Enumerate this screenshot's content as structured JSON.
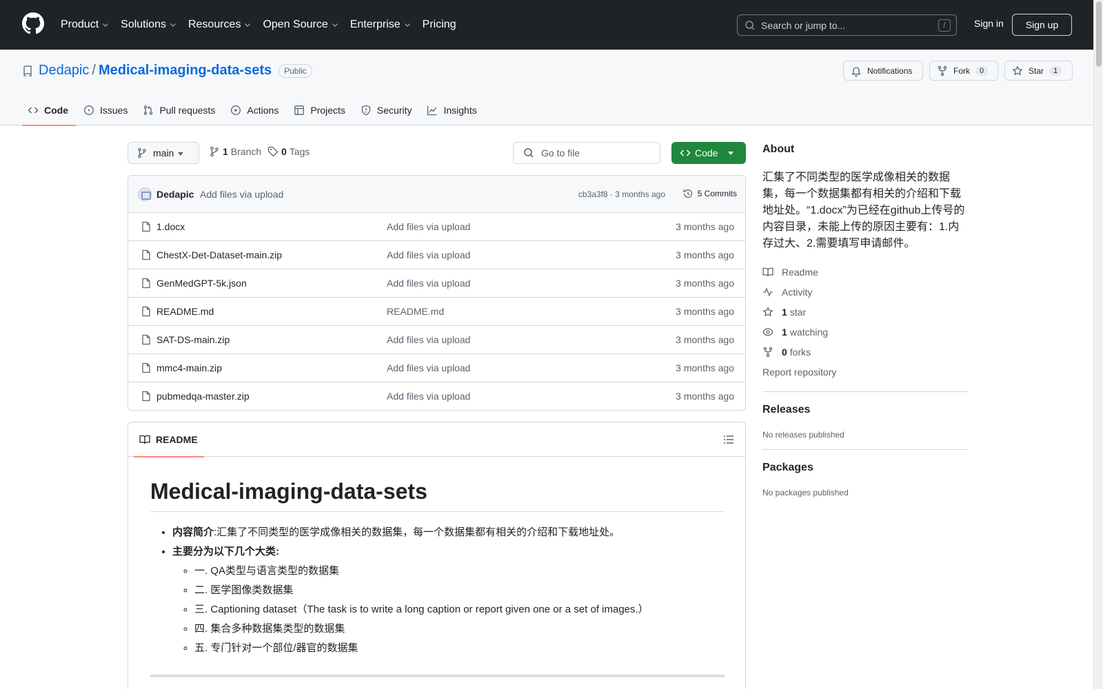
{
  "header": {
    "nav": [
      "Product",
      "Solutions",
      "Resources",
      "Open Source",
      "Enterprise",
      "Pricing"
    ],
    "search_placeholder": "Search or jump to...",
    "search_shortcut": "/",
    "sign_in": "Sign in",
    "sign_up": "Sign up"
  },
  "repo": {
    "owner": "Dedapic",
    "separator": "/",
    "name": "Medical-imaging-data-sets",
    "visibility": "Public",
    "notifications_label": "Notifications",
    "fork_label": "Fork",
    "fork_count": "0",
    "star_label": "Star",
    "star_count": "1"
  },
  "tabs": [
    {
      "label": "Code",
      "icon": "code-icon"
    },
    {
      "label": "Issues",
      "icon": "issue-icon"
    },
    {
      "label": "Pull requests",
      "icon": "pull-request-icon"
    },
    {
      "label": "Actions",
      "icon": "play-icon"
    },
    {
      "label": "Projects",
      "icon": "table-icon"
    },
    {
      "label": "Security",
      "icon": "shield-icon"
    },
    {
      "label": "Insights",
      "icon": "graph-icon"
    }
  ],
  "toolbar": {
    "branch": "main",
    "branch_count": "1",
    "branch_label": "Branch",
    "tag_count": "0",
    "tag_label": "Tags",
    "goto_placeholder": "Go to file",
    "code_button": "Code"
  },
  "commit": {
    "author": "Dedapic",
    "message": "Add files via upload",
    "meta": "cb3a3f8 · 3 months ago",
    "count": "5 Commits"
  },
  "files": [
    {
      "name": "1.docx",
      "message": "Add files via upload",
      "time": "3 months ago"
    },
    {
      "name": "ChestX-Det-Dataset-main.zip",
      "message": "Add files via upload",
      "time": "3 months ago"
    },
    {
      "name": "GenMedGPT-5k.json",
      "message": "Add files via upload",
      "time": "3 months ago"
    },
    {
      "name": "README.md",
      "message": "README.md",
      "time": "3 months ago"
    },
    {
      "name": "SAT-DS-main.zip",
      "message": "Add files via upload",
      "time": "3 months ago"
    },
    {
      "name": "mmc4-main.zip",
      "message": "Add files via upload",
      "time": "3 months ago"
    },
    {
      "name": "pubmedqa-master.zip",
      "message": "Add files via upload",
      "time": "3 months ago"
    }
  ],
  "readme": {
    "tab_label": "README",
    "title": "Medical-imaging-data-sets",
    "intro_label": "内容简介",
    "intro_text": ":汇集了不同类型的医学成像相关的数据集，每一个数据集都有相关的介绍和下载地址处。",
    "categories_label": "主要分为以下几个大类:",
    "categories": [
      "一. QA类型与语言类型的数据集",
      "二. 医学图像类数据集",
      "三. Captioning dataset（The task is to write a long caption or report given one or a set of images.）",
      "四. 集合多种数据集类型的数据集",
      "五. 专门针对一个部位/器官的数据集"
    ]
  },
  "about": {
    "heading": "About",
    "description": "汇集了不同类型的医学成像相关的数据集，每一个数据集都有相关的介绍和下载地址处。“1.docx”为已经在github上传号的内容目录，未能上传的原因主要有：1.内存过大、2.需要填写申请邮件。",
    "readme": "Readme",
    "activity": "Activity",
    "stars_count": "1",
    "stars_label": "star",
    "watching_count": "1",
    "watching_label": "watching",
    "forks_count": "0",
    "forks_label": "forks",
    "report": "Report repository"
  },
  "releases": {
    "heading": "Releases",
    "text": "No releases published"
  },
  "packages": {
    "heading": "Packages",
    "text": "No packages published"
  }
}
